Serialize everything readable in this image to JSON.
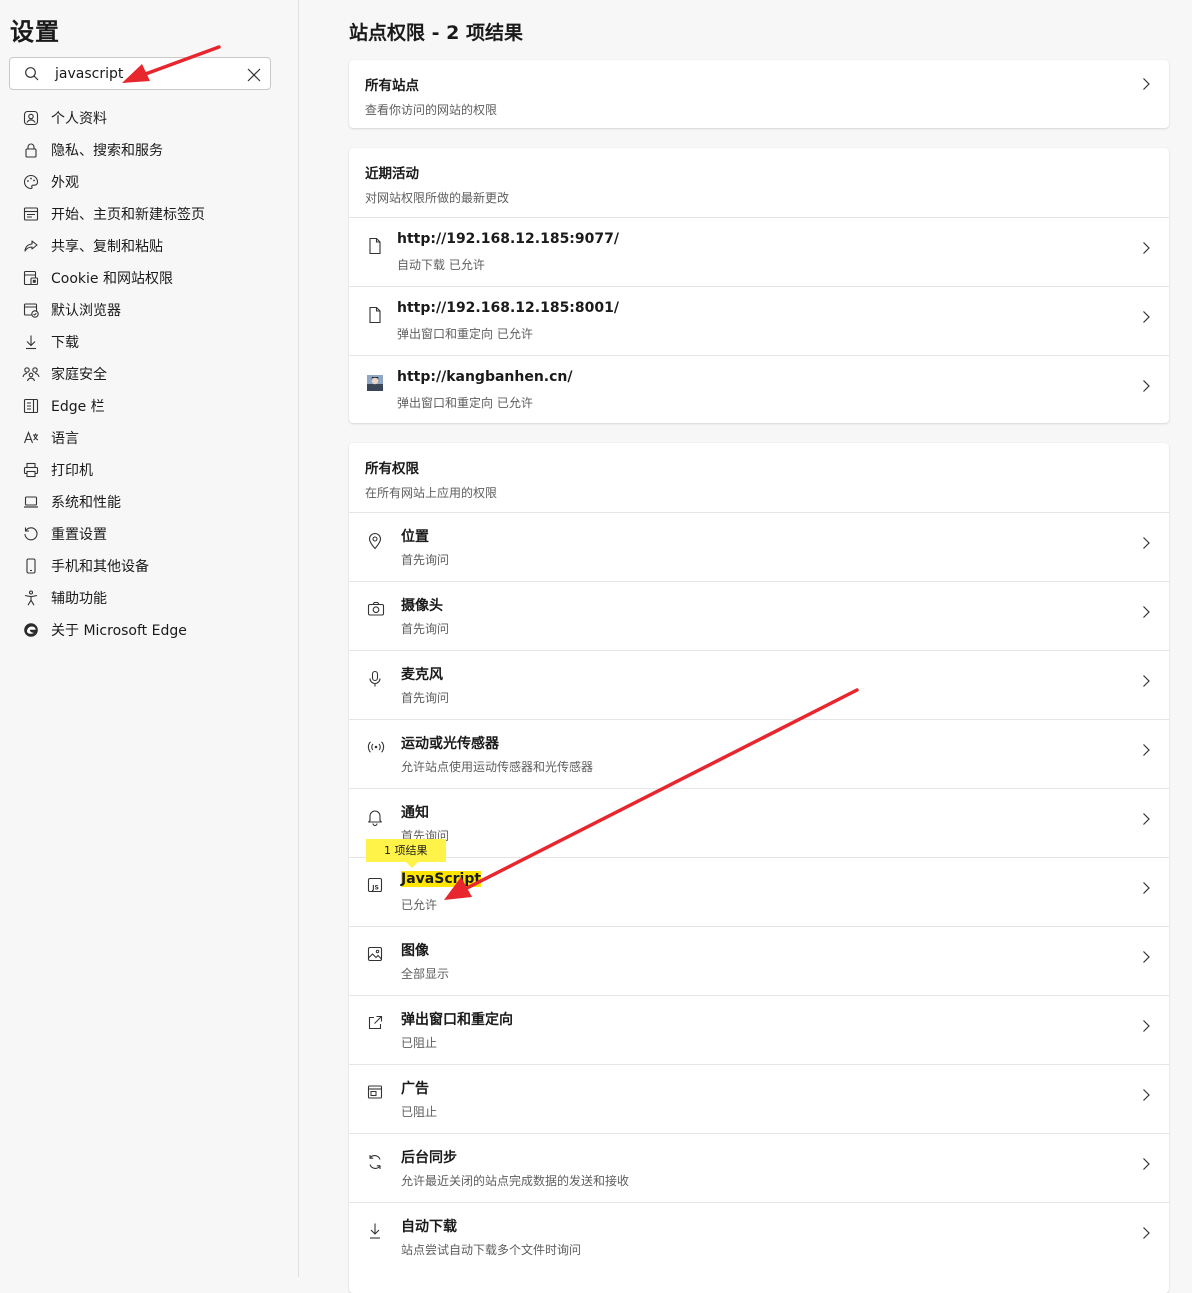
{
  "sidebar": {
    "title": "设置",
    "search": {
      "value": "javascript"
    },
    "items": [
      {
        "label": "个人资料",
        "icon": "profile-icon"
      },
      {
        "label": "隐私、搜索和服务",
        "icon": "lock-icon"
      },
      {
        "label": "外观",
        "icon": "palette-icon"
      },
      {
        "label": "开始、主页和新建标签页",
        "icon": "home-tabs-icon"
      },
      {
        "label": "共享、复制和粘贴",
        "icon": "share-icon"
      },
      {
        "label": "Cookie 和网站权限",
        "icon": "cookie-permissions-icon"
      },
      {
        "label": "默认浏览器",
        "icon": "default-browser-icon"
      },
      {
        "label": "下载",
        "icon": "download-icon"
      },
      {
        "label": "家庭安全",
        "icon": "family-icon"
      },
      {
        "label": "Edge 栏",
        "icon": "edge-bar-icon"
      },
      {
        "label": "语言",
        "icon": "language-icon"
      },
      {
        "label": "打印机",
        "icon": "printer-icon"
      },
      {
        "label": "系统和性能",
        "icon": "laptop-icon"
      },
      {
        "label": "重置设置",
        "icon": "reset-icon"
      },
      {
        "label": "手机和其他设备",
        "icon": "phone-icon"
      },
      {
        "label": "辅助功能",
        "icon": "accessibility-icon"
      },
      {
        "label": "关于 Microsoft Edge",
        "icon": "edge-logo-icon"
      }
    ]
  },
  "main": {
    "title": "站点权限 - 2 项结果",
    "all_sites": {
      "title": "所有站点",
      "subtitle": "查看你访问的网站的权限"
    },
    "recent": {
      "title": "近期活动",
      "subtitle": "对网站权限所做的最新更改",
      "items": [
        {
          "url": "http://192.168.12.185:9077/",
          "detail": "自动下载 已允许",
          "icon": "page-icon"
        },
        {
          "url": "http://192.168.12.185:8001/",
          "detail": "弹出窗口和重定向 已允许",
          "icon": "page-icon"
        },
        {
          "url": "http://kangbanhen.cn/",
          "detail": "弹出窗口和重定向 已允许",
          "icon": "site-favicon"
        }
      ]
    },
    "permissions": {
      "title": "所有权限",
      "subtitle": "在所有网站上应用的权限",
      "badge": "1 项结果",
      "items": [
        {
          "name": "位置",
          "status": "首先询问",
          "icon": "location-icon"
        },
        {
          "name": "摄像头",
          "status": "首先询问",
          "icon": "camera-icon"
        },
        {
          "name": "麦克风",
          "status": "首先询问",
          "icon": "microphone-icon"
        },
        {
          "name": "运动或光传感器",
          "status": "允许站点使用运动传感器和光传感器",
          "icon": "sensor-icon"
        },
        {
          "name": "通知",
          "status": "首先询问",
          "icon": "bell-icon"
        },
        {
          "name": "JavaScript",
          "status": "已允许",
          "icon": "javascript-icon"
        },
        {
          "name": "图像",
          "status": "全部显示",
          "icon": "image-icon"
        },
        {
          "name": "弹出窗口和重定向",
          "status": "已阻止",
          "icon": "popup-icon"
        },
        {
          "name": "广告",
          "status": "已阻止",
          "icon": "ads-icon"
        },
        {
          "name": "后台同步",
          "status": "允许最近关闭的站点完成数据的发送和接收",
          "icon": "sync-icon"
        },
        {
          "name": "自动下载",
          "status": "站点尝试自动下载多个文件时询问",
          "icon": "download-icon"
        }
      ]
    }
  },
  "annotation_color": "#e8262d",
  "highlight_color": "#ffe500"
}
